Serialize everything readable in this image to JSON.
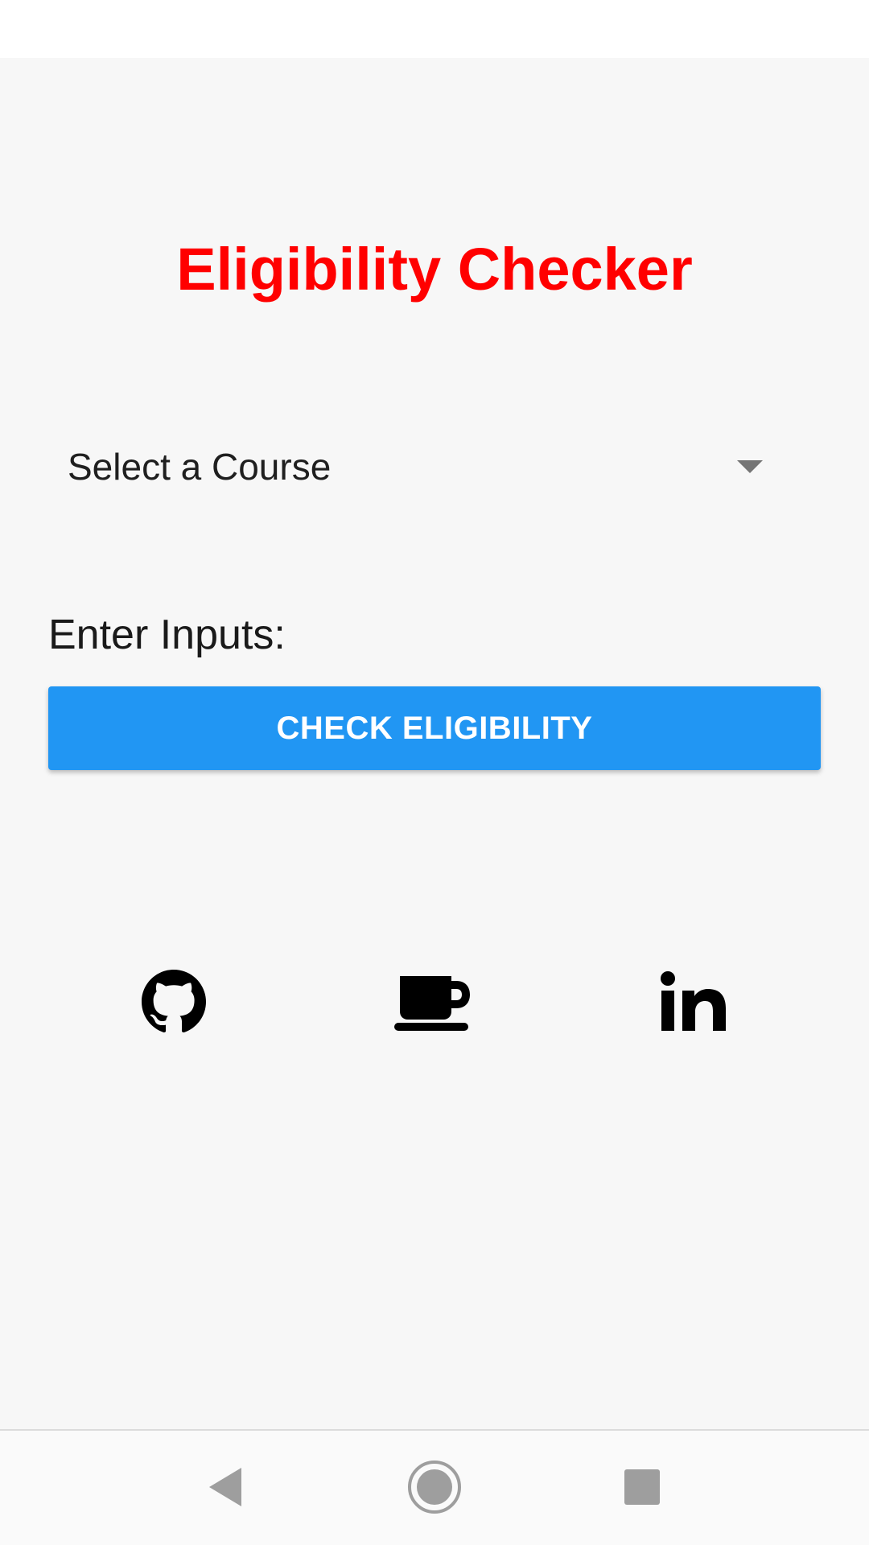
{
  "app": {
    "title": "Eligibility Checker",
    "title_color": "#ff0000"
  },
  "course_select": {
    "selected": "Select a Course"
  },
  "inputs": {
    "label": "Enter Inputs:"
  },
  "check_button": {
    "label": "CHECK ELIGIBILITY",
    "color": "#2196f3"
  },
  "social_links": [
    {
      "icon": "github-icon"
    },
    {
      "icon": "coffee-cup-icon"
    },
    {
      "icon": "linkedin-icon"
    }
  ],
  "nav_bar": {
    "buttons": [
      "back-icon",
      "home-icon",
      "recents-icon"
    ]
  }
}
